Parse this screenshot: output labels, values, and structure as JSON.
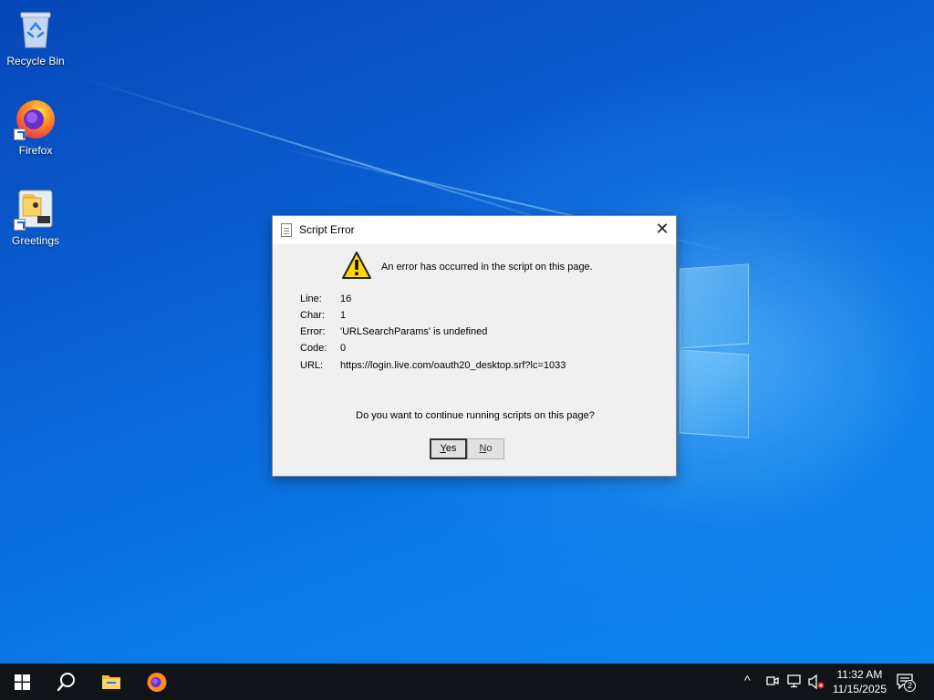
{
  "desktop": {
    "icons": [
      {
        "label": "Recycle Bin",
        "icon": "recycle-bin-icon"
      },
      {
        "label": "Firefox",
        "icon": "firefox-icon"
      },
      {
        "label": "Greetings",
        "icon": "folder-app-icon"
      }
    ]
  },
  "dialog": {
    "title": "Script Error",
    "close_glyph": "✕",
    "headline": "An error has occurred in the script on this page.",
    "details": [
      {
        "label": "Line:",
        "value": "16"
      },
      {
        "label": "Char:",
        "value": "1"
      },
      {
        "label": "Error:",
        "value": "'URLSearchParams' is undefined"
      },
      {
        "label": "Code:",
        "value": "0"
      },
      {
        "label": "URL:",
        "value": "https://login.live.com/oauth20_desktop.srf?lc=1033"
      }
    ],
    "question": "Do you want to continue running scripts on this page?",
    "yes_label_mnemonic": "Y",
    "yes_label_rest": "es",
    "no_label_mnemonic": "N",
    "no_label_rest": "o"
  },
  "taskbar": {
    "start_icon": "windows-start-icon",
    "search_icon": "search-icon",
    "pinned": [
      "file-explorer-icon",
      "firefox-icon"
    ],
    "tray": {
      "chevron": "^",
      "time": "11:32 AM",
      "date": "11/15/2025",
      "notification_count": "2"
    }
  },
  "colors": {
    "accent": "#0a63d6",
    "dialog_bg": "#f0f0f0",
    "taskbar_bg": "#101418",
    "warning_yellow": "#ffd800"
  }
}
